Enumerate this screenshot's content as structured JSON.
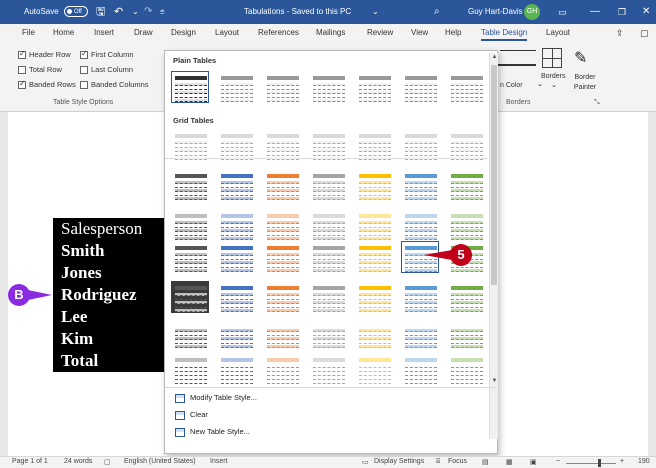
{
  "titlebar": {
    "autosave": "AutoSave",
    "autosave_state": "Off",
    "title": "Tabulations - Saved to this PC",
    "user": "Guy Hart-Davis",
    "user_initials": "GH"
  },
  "tabs": [
    "File",
    "Home",
    "Insert",
    "Draw",
    "Design",
    "Layout",
    "References",
    "Mailings",
    "Review",
    "View",
    "Help",
    "Table Design",
    "Layout"
  ],
  "ribbon": {
    "options": {
      "header_row": "Header Row",
      "first_column": "First Column",
      "total_row": "Total Row",
      "last_column": "Last Column",
      "banded_rows": "Banded Rows",
      "banded_columns": "Banded Columns"
    },
    "group_table_style_options": "Table Style Options",
    "borders_label": "Borders",
    "border_painter_label": "Border Painter",
    "pen_color": "n Color",
    "group_borders": "Borders"
  },
  "gallery": {
    "plain_tables": "Plain Tables",
    "grid_tables": "Grid Tables",
    "modify": "Modify Table Style...",
    "clear": "Clear",
    "new_style": "New Table Style..."
  },
  "document": {
    "rows": [
      "Salesperson",
      "Smith",
      "Jones",
      "Rodriguez",
      "Lee",
      "Kim",
      "Total"
    ]
  },
  "callouts": {
    "b": "B",
    "five": "5"
  },
  "statusbar": {
    "page": "Page 1 of 1",
    "words": "24 words",
    "language": "English (United States)",
    "insert": "Insert",
    "display_settings": "Display Settings",
    "focus": "Focus",
    "zoom": "190"
  },
  "colors": {
    "brand": "#2b579a",
    "callout_b": "#8a2be2",
    "callout_5": "#c00018"
  }
}
